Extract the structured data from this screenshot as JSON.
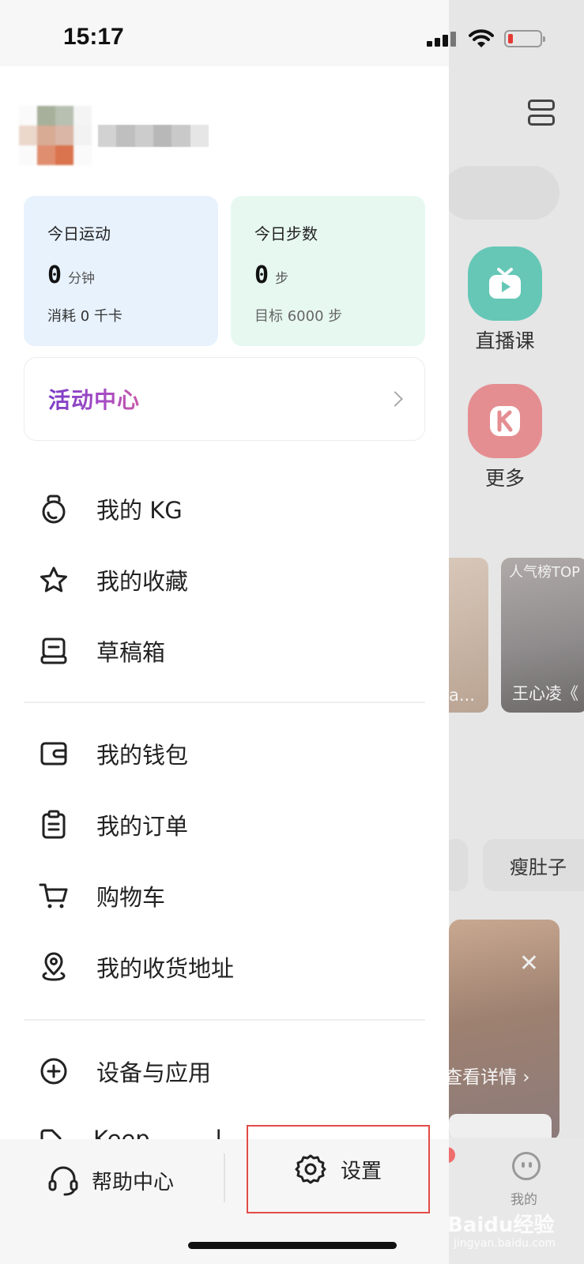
{
  "status_bar": {
    "time": "15:17"
  },
  "background_app": {
    "tiles": [
      {
        "label": "直播课",
        "icon": "tv-play-icon"
      },
      {
        "label": "更多",
        "icon": "k-logo-icon"
      }
    ],
    "cards": [
      {
        "top_text": "",
        "bottom_text": "a..."
      },
      {
        "top_text": "人气榜TOP",
        "bottom_text": "王心凌《"
      }
    ],
    "chip": "瘦肚子",
    "promo_link": "查看详情",
    "tab_me": "我的",
    "watermark": "Baidu经验",
    "watermark_sub": "jingyan.baidu.com"
  },
  "drawer": {
    "stats": {
      "sport": {
        "title": "今日运动",
        "value": "0",
        "unit": "分钟",
        "sub": "消耗 0 千卡"
      },
      "steps": {
        "title": "今日步数",
        "value": "0",
        "unit": "步",
        "sub": "目标 6000 步"
      }
    },
    "activity_center": "活动中心",
    "menu_group_1": [
      {
        "label": "我的 KG",
        "icon": "kettlebell-icon"
      },
      {
        "label": "我的收藏",
        "icon": "star-icon"
      },
      {
        "label": "草稿箱",
        "icon": "drafts-icon"
      }
    ],
    "menu_group_2": [
      {
        "label": "我的钱包",
        "icon": "wallet-icon"
      },
      {
        "label": "我的订单",
        "icon": "clipboard-icon"
      },
      {
        "label": "购物车",
        "icon": "cart-icon"
      },
      {
        "label": "我的收货地址",
        "icon": "location-pin-icon"
      }
    ],
    "menu_group_3": [
      {
        "label": "设备与应用",
        "icon": "plus-circle-icon"
      }
    ],
    "peek_item": "Keep         l",
    "bottom": {
      "help": "帮助中心",
      "settings": "设置"
    }
  }
}
